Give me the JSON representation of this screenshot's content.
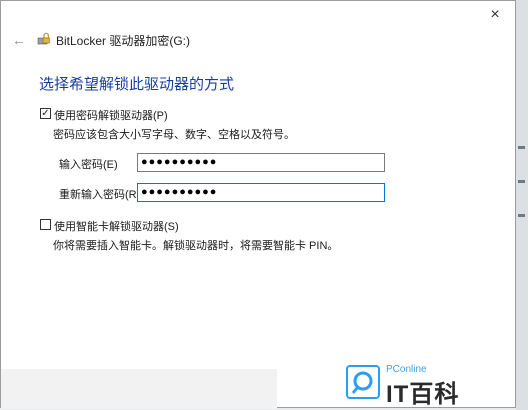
{
  "window": {
    "title": "BitLocker 驱动器加密(G:)",
    "close_glyph": "×",
    "back_glyph": "←"
  },
  "heading": "选择希望解锁此驱动器的方式",
  "password_option": {
    "checked": true,
    "label": "使用密码解锁驱动器(P)",
    "hint": "密码应该包含大小写字母、数字、空格以及符号。",
    "enter_label": "输入密码(E)",
    "enter_value": "●●●●●●●●●●",
    "reenter_label": "重新输入密码(R)",
    "reenter_value": "●●●●●●●●●●"
  },
  "smartcard_option": {
    "checked": false,
    "label": "使用智能卡解锁驱动器(S)",
    "hint": "你将需要插入智能卡。解锁驱动器时，将需要智能卡 PIN。"
  },
  "watermark": {
    "small": "PConline",
    "big": "IT百科"
  },
  "colors": {
    "heading": "#1a3e9e",
    "focus_border": "#0078d7",
    "logo_blue": "#2a9df4"
  }
}
